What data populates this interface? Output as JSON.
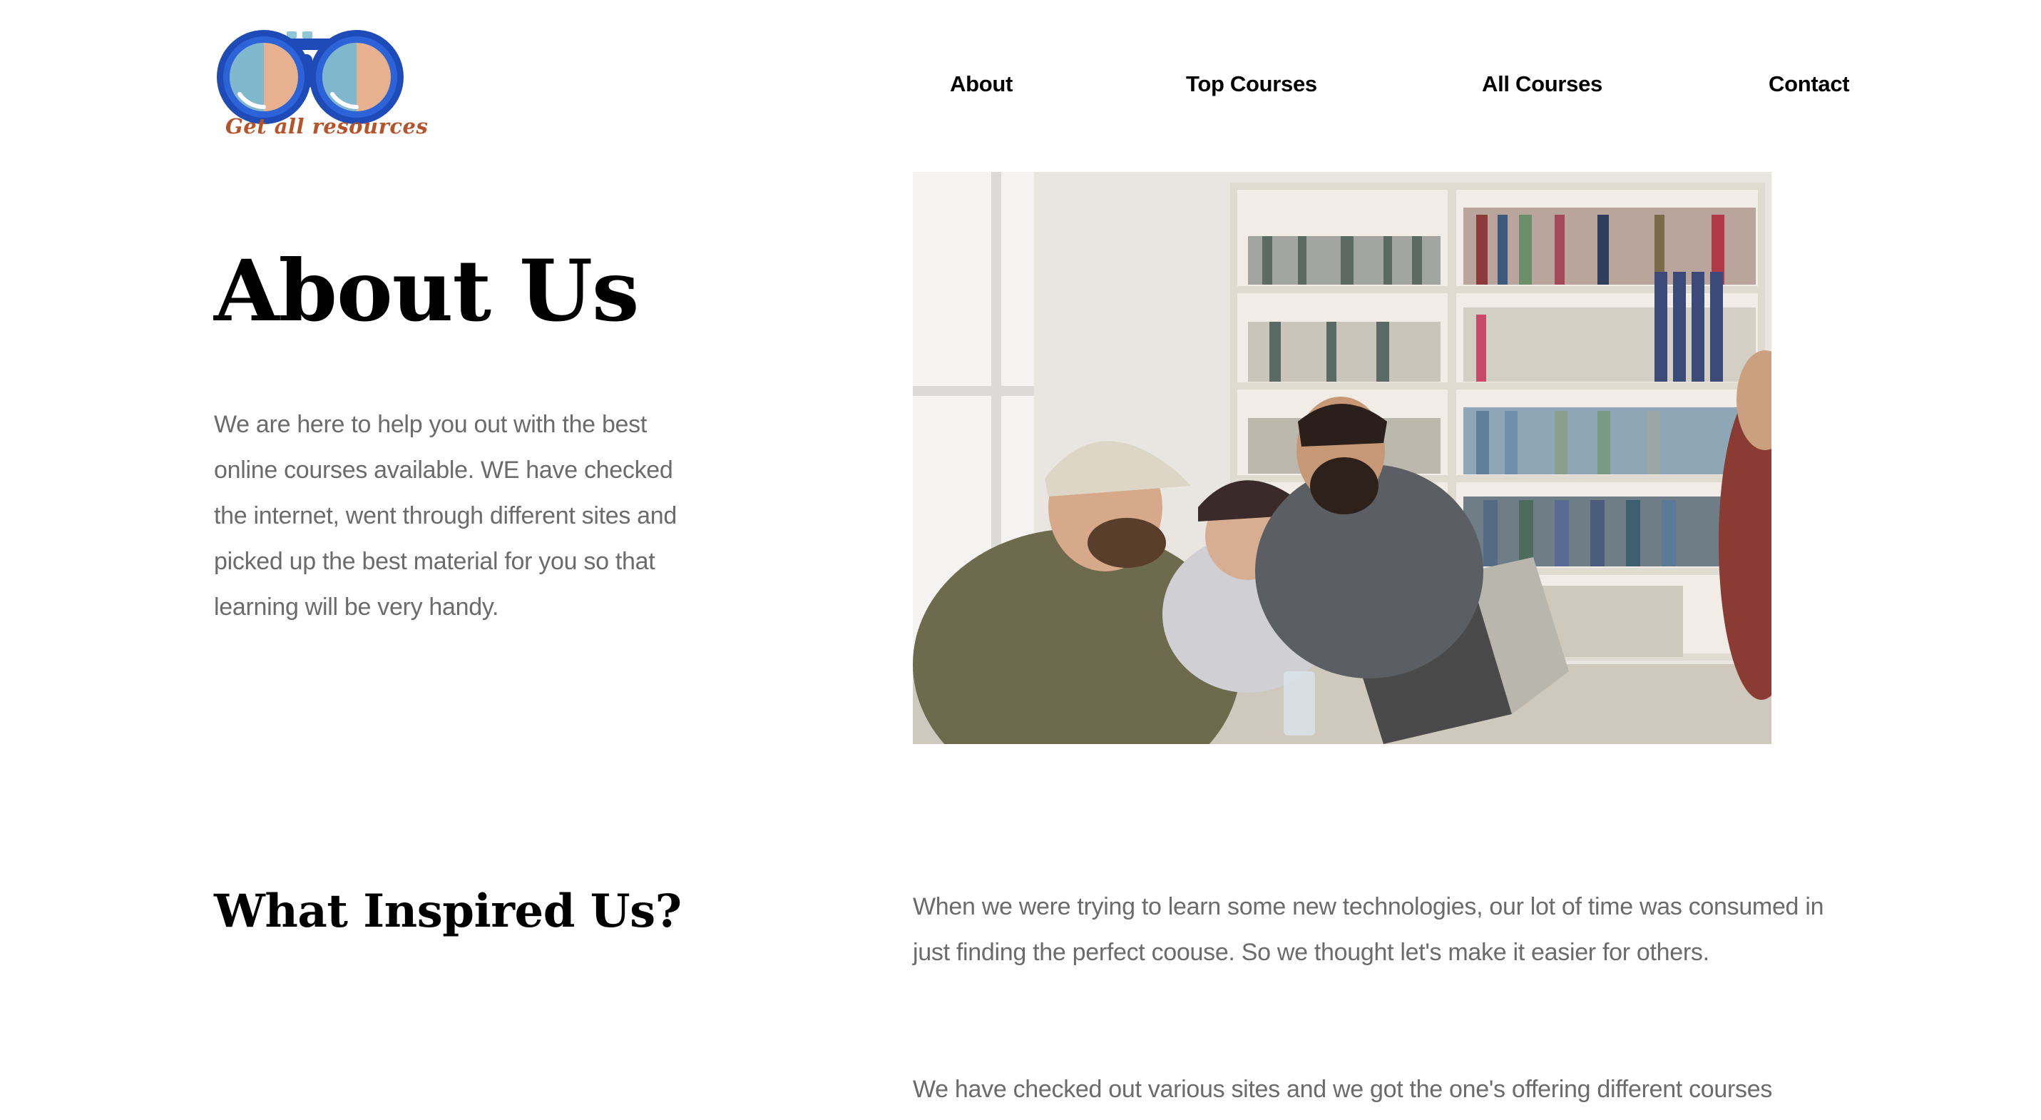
{
  "brand": {
    "logo_text": "Get all resources",
    "icon": "binoculars-logo-icon",
    "colors": {
      "blue": "#1f4bb8",
      "lens": "#e7b08f",
      "text": "#b5532a"
    }
  },
  "nav": {
    "items": [
      {
        "label": "About"
      },
      {
        "label": "Top Courses"
      },
      {
        "label": "All Courses"
      },
      {
        "label": "Contact"
      }
    ]
  },
  "hero": {
    "title": "About Us",
    "text": "We are here to help you out with the best online courses available. WE have checked the internet, went through different sites and picked up the best material for you so that learning will be very handy.",
    "image": "students-laughing-at-laptops-in-library-photo"
  },
  "inspired": {
    "title": "What Inspired Us?",
    "paragraphs": [
      "When we were trying to learn some new technologies, our lot of time was consumed in just finding the perfect coouse. So we thought let's make it easier for others.",
      "We have checked out various sites and we got the one's offering different courses"
    ]
  },
  "colors": {
    "body_text": "#6b6b6b",
    "heading": "#000000",
    "background": "#ffffff"
  }
}
